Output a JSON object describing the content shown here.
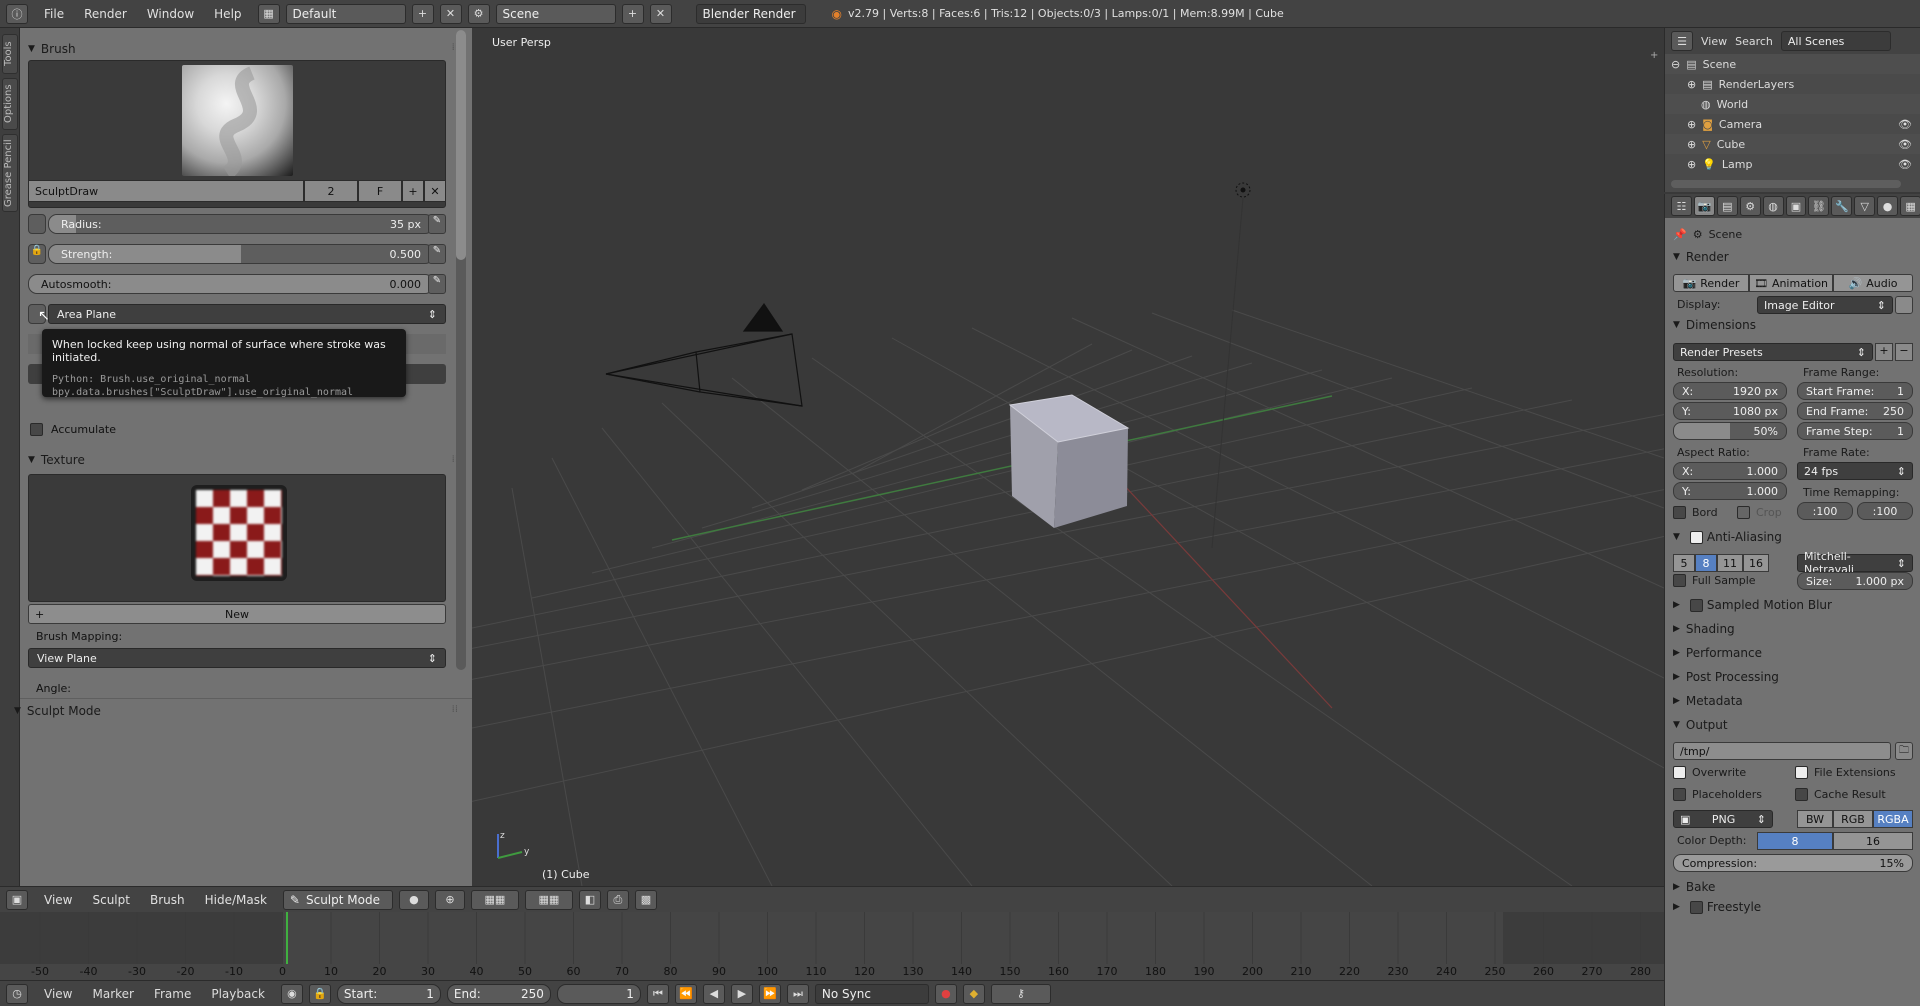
{
  "topbar": {
    "menus": [
      "File",
      "Render",
      "Window",
      "Help"
    ],
    "layout": "Default",
    "scene": "Scene",
    "engine": "Blender Render",
    "stats": "v2.79 | Verts:8 | Faces:6 | Tris:12 | Objects:0/3 | Lamps:0/1 | Mem:8.99M | Cube"
  },
  "tabs": [
    "Tools",
    "Options",
    "Grease Pencil"
  ],
  "tool": {
    "brush_title": "Brush",
    "brush_name": "SculptDraw",
    "brush_users": "2",
    "brush_fake": "F",
    "radius_label": "Radius:",
    "radius_value": "35 px",
    "radius_fraction": 0.07,
    "strength_label": "Strength:",
    "strength_value": "0.500",
    "strength_fraction": 0.5,
    "autosmooth_label": "Autosmooth:",
    "autosmooth_value": "0.000",
    "sculpt_plane": "Area Plane",
    "tooltip_title": "When locked keep using normal of surface where stroke was initiated.",
    "tooltip_python1": "Python: Brush.use_original_normal",
    "tooltip_python2": "bpy.data.brushes[\"SculptDraw\"].use_original_normal",
    "accumulate": "Accumulate",
    "texture_title": "Texture",
    "texture_new": "New",
    "brush_mapping_label": "Brush Mapping:",
    "brush_mapping": "View Plane",
    "angle_label": "Angle:",
    "sculpt_mode_title": "Sculpt Mode"
  },
  "viewport": {
    "label": "User Persp",
    "object_label": "(1) Cube"
  },
  "viewheader": {
    "menus": [
      "View",
      "Sculpt",
      "Brush",
      "Hide/Mask"
    ],
    "mode": "Sculpt Mode"
  },
  "timeline": {
    "ticks": [
      "-50",
      "-40",
      "-30",
      "-20",
      "-10",
      "0",
      "10",
      "20",
      "30",
      "40",
      "50",
      "60",
      "70",
      "80",
      "90",
      "100",
      "110",
      "120",
      "130",
      "140",
      "150",
      "160",
      "170",
      "180",
      "190",
      "200",
      "210",
      "220",
      "230",
      "240",
      "250",
      "260",
      "270",
      "280"
    ],
    "menus": [
      "View",
      "Marker",
      "Frame",
      "Playback"
    ],
    "start_label": "Start:",
    "start_value": "1",
    "end_label": "End:",
    "end_value": "250",
    "current": "1",
    "sync": "No Sync"
  },
  "outliner": {
    "menus": [
      "View",
      "Search"
    ],
    "filter": "All Scenes",
    "items": [
      "Scene",
      "RenderLayers",
      "World",
      "Camera",
      "Cube",
      "Lamp"
    ]
  },
  "props": {
    "context": "Scene",
    "render_title": "Render",
    "render_btn": "Render",
    "animation_btn": "Animation",
    "audio_btn": "Audio",
    "display_label": "Display:",
    "display_value": "Image Editor",
    "dimensions_title": "Dimensions",
    "presets": "Render Presets",
    "resolution_label": "Resolution:",
    "res_x": "X:",
    "res_x_val": "1920 px",
    "res_y": "Y:",
    "res_y_val": "1080 px",
    "res_pct": "50%",
    "frame_range_label": "Frame Range:",
    "start_frame": "Start Frame:",
    "start_frame_val": "1",
    "end_frame": "End Frame:",
    "end_frame_val": "250",
    "frame_step": "Frame Step:",
    "frame_step_val": "1",
    "aspect_label": "Aspect Ratio:",
    "asp_x": "X:",
    "asp_x_val": "1.000",
    "asp_y": "Y:",
    "asp_y_val": "1.000",
    "frame_rate_label": "Frame Rate:",
    "fps": "24 fps",
    "time_remap_label": "Time Remapping:",
    "remap_old": ":100",
    "remap_new": ":100",
    "bord": "Bord",
    "crop": "Crop",
    "aa_title": "Anti-Aliasing",
    "aa_samples": [
      "5",
      "8",
      "11",
      "16"
    ],
    "aa_filter": "Mitchell-Netravali",
    "full_sample": "Full Sample",
    "size_label": "Size:",
    "size_val": "1.000 px",
    "smb": "Sampled Motion Blur",
    "shading": "Shading",
    "performance": "Performance",
    "post": "Post Processing",
    "metadata": "Metadata",
    "output_title": "Output",
    "path": "/tmp/",
    "overwrite": "Overwrite",
    "file_ext": "File Extensions",
    "placeholders": "Placeholders",
    "cache": "Cache Result",
    "format": "PNG",
    "bw": "BW",
    "rgb": "RGB",
    "rgba": "RGBA",
    "color_depth_label": "Color Depth:",
    "depth8": "8",
    "depth16": "16",
    "compression_label": "Compression:",
    "compression_val": "15%",
    "bake": "Bake",
    "freestyle": "Freestyle"
  }
}
